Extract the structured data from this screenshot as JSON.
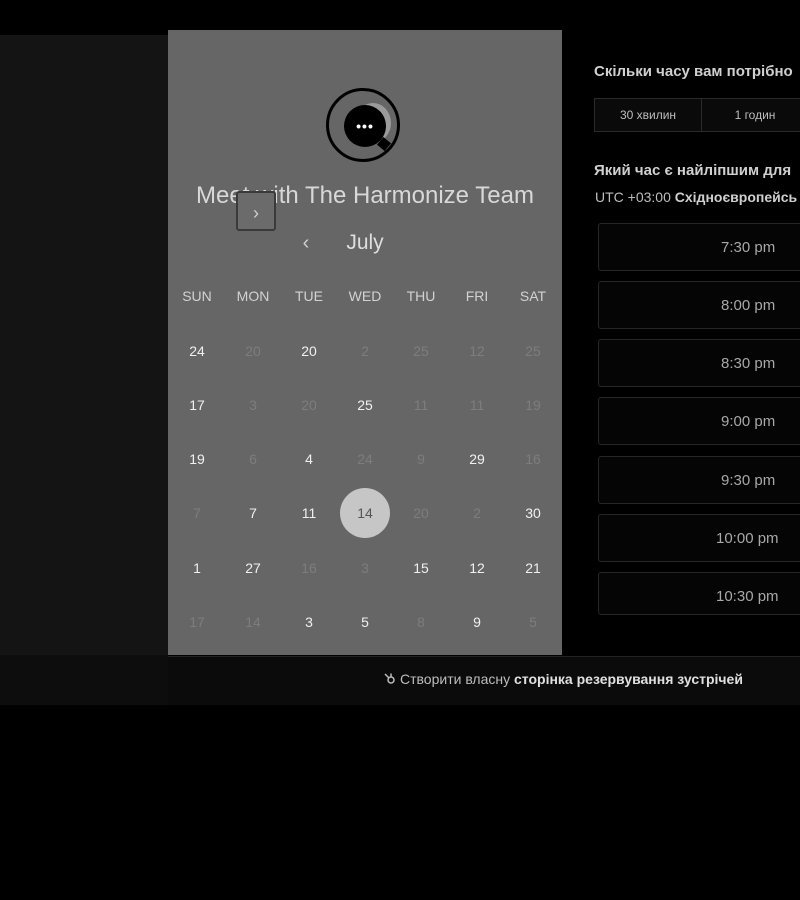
{
  "card": {
    "title": "Meet with The Harmonize Team",
    "logo_dots": "•••",
    "month": "July",
    "prev_glyph": "‹",
    "next_glyph": "›"
  },
  "calendar": {
    "weekdays": [
      "SUN",
      "MON",
      "TUE",
      "WED",
      "THU",
      "FRI",
      "SAT"
    ],
    "weeks": [
      [
        {
          "d": "24",
          "on": true
        },
        {
          "d": "20",
          "on": false
        },
        {
          "d": "20",
          "on": true
        },
        {
          "d": "2",
          "on": false
        },
        {
          "d": "25",
          "on": false
        },
        {
          "d": "12",
          "on": false
        },
        {
          "d": "25",
          "on": false
        }
      ],
      [
        {
          "d": "17",
          "on": true
        },
        {
          "d": "3",
          "on": false
        },
        {
          "d": "20",
          "on": false
        },
        {
          "d": "25",
          "on": true
        },
        {
          "d": "11",
          "on": false
        },
        {
          "d": "11",
          "on": false
        },
        {
          "d": "19",
          "on": false
        }
      ],
      [
        {
          "d": "19",
          "on": true
        },
        {
          "d": "6",
          "on": false
        },
        {
          "d": "4",
          "on": true
        },
        {
          "d": "24",
          "on": false
        },
        {
          "d": "9",
          "on": false
        },
        {
          "d": "29",
          "on": true
        },
        {
          "d": "16",
          "on": false
        }
      ],
      [
        {
          "d": "7",
          "on": false
        },
        {
          "d": "7",
          "on": true
        },
        {
          "d": "11",
          "on": true
        },
        {
          "d": "14",
          "on": true,
          "selected": true
        },
        {
          "d": "20",
          "on": false
        },
        {
          "d": "2",
          "on": false
        },
        {
          "d": "30",
          "on": true
        }
      ],
      [
        {
          "d": "1",
          "on": true
        },
        {
          "d": "27",
          "on": true
        },
        {
          "d": "16",
          "on": false
        },
        {
          "d": "3",
          "on": false
        },
        {
          "d": "15",
          "on": true
        },
        {
          "d": "12",
          "on": true
        },
        {
          "d": "21",
          "on": true
        }
      ],
      [
        {
          "d": "17",
          "on": false
        },
        {
          "d": "14",
          "on": false
        },
        {
          "d": "3",
          "on": true
        },
        {
          "d": "5",
          "on": true
        },
        {
          "d": "8",
          "on": false
        },
        {
          "d": "9",
          "on": true
        },
        {
          "d": "5",
          "on": false
        }
      ]
    ]
  },
  "booking": {
    "duration_heading": "Скільки часу вам потрібно",
    "durations": [
      "30 хвилин",
      "1 годин"
    ],
    "best_time_heading": "Який час є найліпшим для",
    "timezone_prefix": "UTC +03:00",
    "timezone_name": "Східноєвропейсь",
    "slots": [
      "7:30 pm",
      "8:00 pm",
      "8:30 pm",
      "9:00 pm",
      "9:30 pm",
      "10:00 pm",
      "10:30 pm"
    ]
  },
  "footer": {
    "prefix": "Створити власну",
    "link": "сторінка резервування зустрічей",
    "icon": "hubspot-icon"
  }
}
